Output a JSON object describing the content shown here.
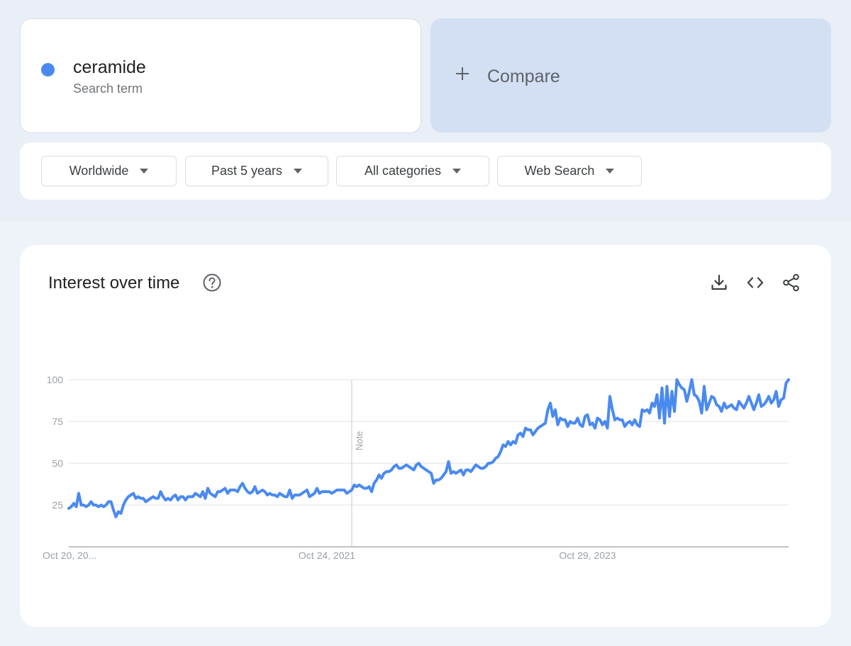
{
  "search_term": {
    "name": "ceramide",
    "subtitle": "Search term",
    "color": "#4a8af0"
  },
  "compare": {
    "label": "Compare"
  },
  "filters": {
    "region": "Worldwide",
    "time_range": "Past 5 years",
    "category": "All categories",
    "property": "Web Search"
  },
  "chart_card": {
    "title": "Interest over time",
    "icons": [
      "help-circle-icon",
      "download-icon",
      "embed-code-icon",
      "share-icon"
    ]
  },
  "chart_data": {
    "type": "line",
    "title": "Interest over time",
    "xlabel": "",
    "ylabel": "",
    "ylim": [
      0,
      100
    ],
    "yticks": [
      25,
      50,
      75,
      100
    ],
    "grid": true,
    "x_tick_labels": [
      "Oct 20, 20...",
      "Oct 24, 2021",
      "Oct 29, 2023"
    ],
    "x_tick_positions": [
      0,
      104,
      209
    ],
    "note_label": "Note",
    "note_position": 114,
    "line_color": "#4a8af0",
    "series": [
      {
        "name": "ceramide",
        "values": [
          23,
          24,
          26,
          24,
          32,
          25,
          25,
          24,
          25,
          27,
          25,
          25,
          24,
          25,
          24,
          25,
          27,
          27,
          22,
          18,
          21,
          20,
          25,
          28,
          30,
          31,
          32,
          29,
          30,
          29,
          29,
          27,
          28,
          29,
          30,
          29,
          29,
          33,
          30,
          28,
          29,
          28,
          30,
          31,
          28,
          30,
          30,
          28,
          30,
          30,
          30,
          32,
          31,
          30,
          33,
          29,
          35,
          32,
          31,
          30,
          33,
          33,
          34,
          35,
          32,
          34,
          34,
          34,
          33,
          36,
          38,
          35,
          33,
          32,
          33,
          36,
          32,
          33,
          34,
          33,
          31,
          32,
          31,
          31,
          30,
          32,
          31,
          30,
          30,
          34,
          29,
          31,
          31,
          31,
          32,
          33,
          34,
          30,
          31,
          32,
          35,
          32,
          33,
          33,
          33,
          33,
          32,
          33,
          34,
          34,
          34,
          34,
          32,
          33,
          34,
          37,
          36,
          37,
          36,
          35,
          35,
          36,
          33,
          38,
          40,
          43,
          41,
          44,
          45,
          45,
          46,
          48,
          49,
          47,
          47,
          48,
          49,
          48,
          47,
          46,
          49,
          50,
          48,
          47,
          46,
          45,
          44,
          38,
          40,
          40,
          41,
          43,
          45,
          51,
          44,
          45,
          44,
          45,
          46,
          43,
          46,
          46,
          45,
          47,
          49,
          48,
          47,
          47,
          48,
          50,
          50,
          51,
          53,
          54,
          57,
          61,
          60,
          63,
          61,
          63,
          62,
          67,
          68,
          66,
          71,
          70,
          70,
          67,
          69,
          71,
          72,
          73,
          74,
          82,
          86,
          78,
          82,
          73,
          77,
          76,
          76,
          72,
          75,
          74,
          74,
          77,
          73,
          72,
          78,
          79,
          73,
          74,
          71,
          77,
          76,
          73,
          75,
          71,
          90,
          82,
          76,
          77,
          76,
          76,
          72,
          74,
          75,
          73,
          76,
          73,
          72,
          82,
          81,
          82,
          80,
          86,
          84,
          91,
          77,
          95,
          74,
          96,
          78,
          93,
          81,
          100,
          97,
          95,
          94,
          87,
          93,
          100,
          91,
          90,
          87,
          80,
          96,
          82,
          86,
          90,
          89,
          85,
          84,
          81,
          86,
          83,
          84,
          85,
          83,
          82,
          87,
          85,
          83,
          86,
          90,
          86,
          82,
          86,
          91,
          84,
          85,
          87,
          90,
          86,
          88,
          93,
          84,
          88,
          89,
          98,
          100
        ]
      }
    ]
  }
}
